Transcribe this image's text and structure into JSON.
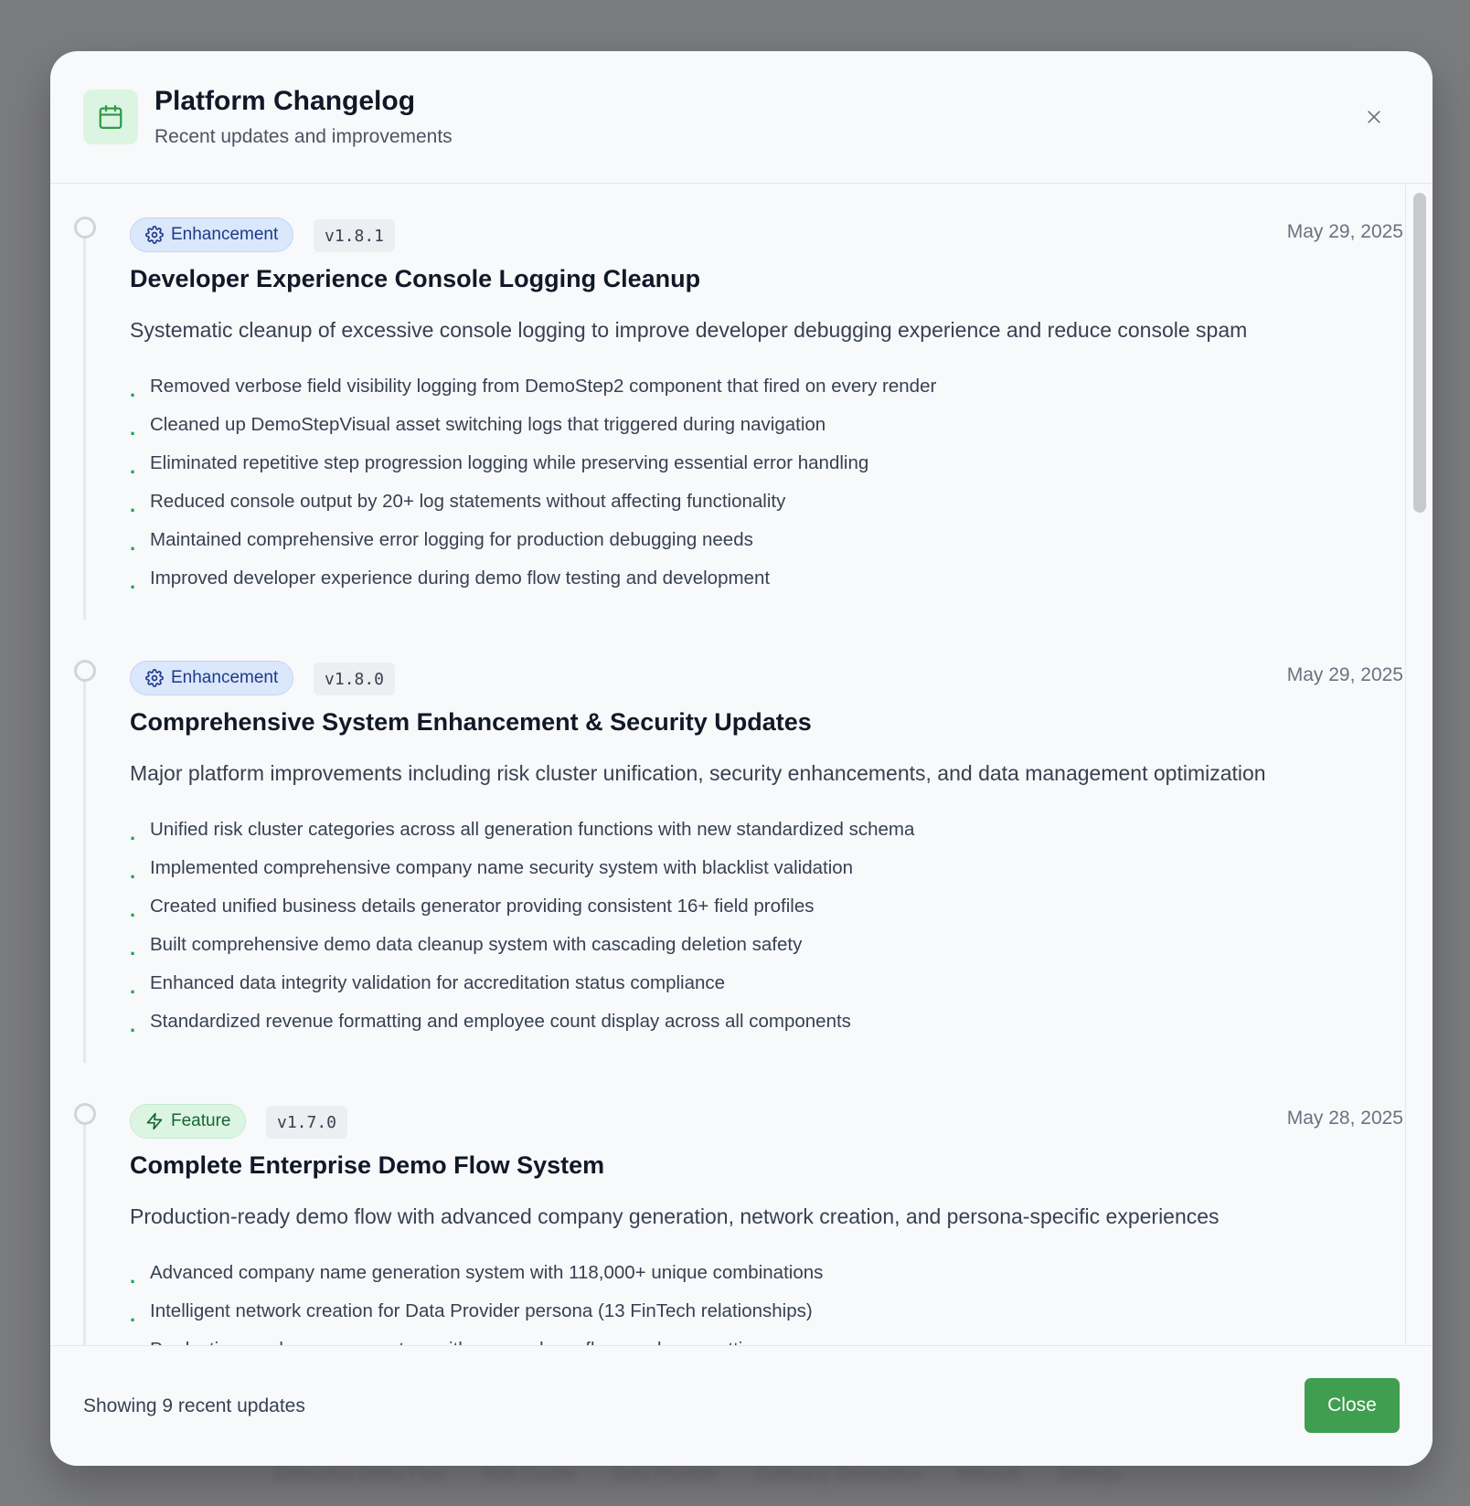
{
  "backdrop": {
    "items": [
      "Enterprise Demo Flow",
      "Risk Cluster",
      "Data Provider",
      "Company Generation",
      "Network",
      "Settings"
    ]
  },
  "modal": {
    "title": "Platform Changelog",
    "subtitle": "Recent updates and improvements",
    "header_icon": "calendar-icon",
    "close_icon": "close-icon",
    "accent_color": "#3f9e4f"
  },
  "entries": [
    {
      "type": "Enhancement",
      "type_icon": "gear-icon",
      "version": "v1.8.1",
      "date": "May 29, 2025",
      "title": "Developer Experience Console Logging Cleanup",
      "description": "Systematic cleanup of excessive console logging to improve developer debugging experience and reduce console spam",
      "items": [
        "Removed verbose field visibility logging from DemoStep2 component that fired on every render",
        "Cleaned up DemoStepVisual asset switching logs that triggered during navigation",
        "Eliminated repetitive step progression logging while preserving essential error handling",
        "Reduced console output by 20+ log statements without affecting functionality",
        "Maintained comprehensive error logging for production debugging needs",
        "Improved developer experience during demo flow testing and development"
      ]
    },
    {
      "type": "Enhancement",
      "type_icon": "gear-icon",
      "version": "v1.8.0",
      "date": "May 29, 2025",
      "title": "Comprehensive System Enhancement & Security Updates",
      "description": "Major platform improvements including risk cluster unification, security enhancements, and data management optimization",
      "items": [
        "Unified risk cluster categories across all generation functions with new standardized schema",
        "Implemented comprehensive company name security system with blacklist validation",
        "Created unified business details generator providing consistent 16+ field profiles",
        "Built comprehensive demo data cleanup system with cascading deletion safety",
        "Enhanced data integrity validation for accreditation status compliance",
        "Standardized revenue formatting and employee count display across all components"
      ]
    },
    {
      "type": "Feature",
      "type_icon": "lightning-icon",
      "version": "v1.7.0",
      "date": "May 28, 2025",
      "title": "Complete Enterprise Demo Flow System",
      "description": "Production-ready demo flow with advanced company generation, network creation, and persona-specific experiences",
      "items": [
        "Advanced company name generation system with 118,000+ unique combinations",
        "Intelligent network creation for Data Provider persona (13 FinTech relationships)",
        "Production-ready persona system with proper demo flags and user settings"
      ]
    }
  ],
  "footer": {
    "summary": "Showing 9 recent updates",
    "close_label": "Close"
  }
}
